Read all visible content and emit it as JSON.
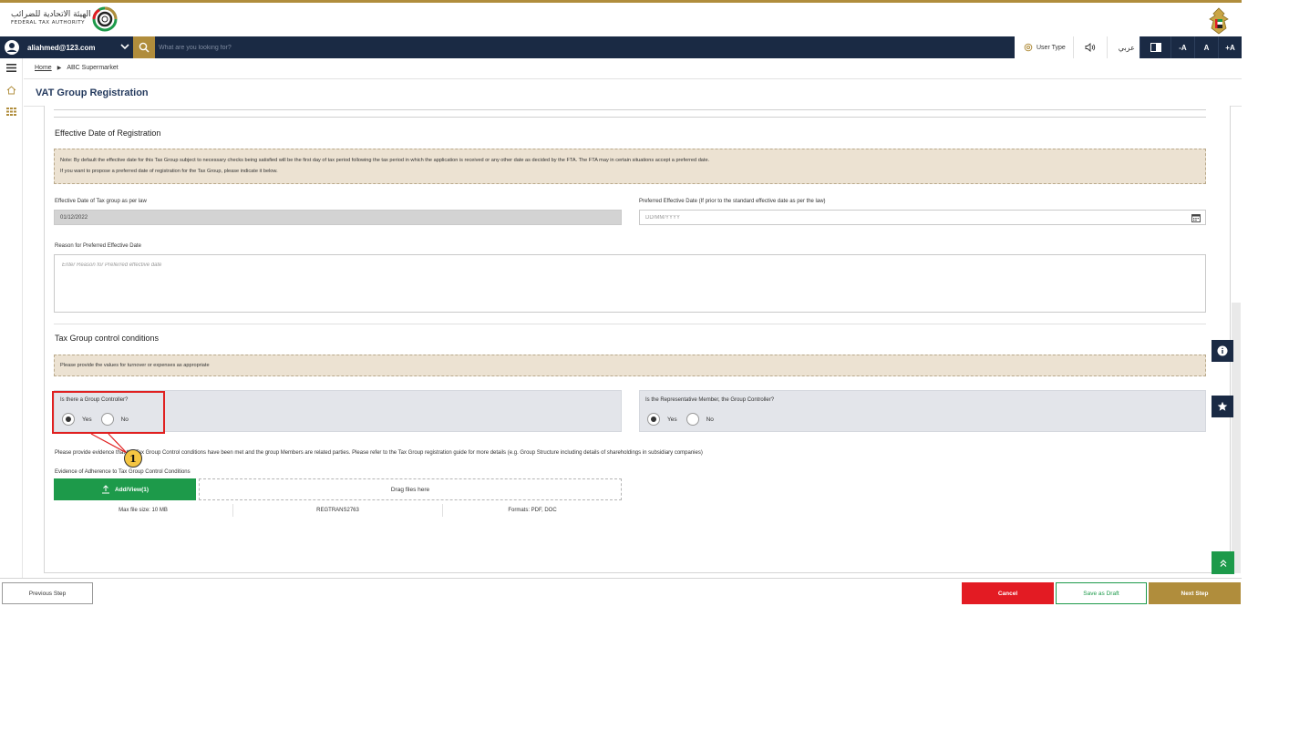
{
  "header": {
    "logo_ar": "الهيئة الاتحادية للضرائب",
    "logo_en": "FEDERAL TAX AUTHORITY"
  },
  "nav": {
    "user_email": "aliahmed@123.com",
    "search_placeholder": "What are you looking for?",
    "user_type_label": "User Type",
    "language_label": "عربي",
    "font_decrease": "-A",
    "font_normal": "A",
    "font_increase": "+A"
  },
  "breadcrumb": {
    "home": "Home",
    "current": "ABC Supermarket"
  },
  "page": {
    "title": "VAT Group Registration"
  },
  "effective_date": {
    "section_title": "Effective Date of Registration",
    "note_line1": "Note: By default the effective date for this Tax Group subject to necessary checks being satisfied will be the first day of tax period following the tax period in which the application is received or any other date as decided by the FTA. The FTA may in certain situations accept a preferred date.",
    "note_line2": "If you want to propose a preferred date of registration for the Tax Group, please indicate it below.",
    "law_date_label": "Effective Date of Tax group as per law",
    "law_date_value": "01/12/2022",
    "preferred_date_label": "Preferred Effective Date (If prior to the standard effective date as per the law)",
    "preferred_date_placeholder": "DD/MM/YYYY",
    "reason_label": "Reason for Preferred Effective Date",
    "reason_placeholder": "Enter Reason for Preferred effective date"
  },
  "control": {
    "section_title": "Tax Group control conditions",
    "note": "Please provide the values for turnover or expenses as appropriate",
    "q1": "Is there a Group Controller?",
    "q1_selected": "Yes",
    "q2": "Is the Representative Member, the Group Controller?",
    "q2_selected": "Yes",
    "yes_label": "Yes",
    "no_label": "No",
    "evidence_text": "Please provide evidence that the Tax Group Control conditions have been met and the group Members are related parties. Please refer to the Tax Group registration guide for more details (e.g. Group Structure including details of shareholdings in subsidiary companies)",
    "evidence_label": "Evidence of Adherence to Tax Group Control Conditions",
    "add_view_label": "Add/View(1)",
    "drag_label": "Drag files here",
    "max_size": "Max file size: 10 MB",
    "ref": "REGTRANS2763",
    "formats": "Formats: PDF, DOC"
  },
  "annotation": {
    "badge": "1"
  },
  "footer": {
    "previous": "Previous Step",
    "cancel": "Cancel",
    "save_draft": "Save as Draft",
    "next": "Next Step"
  },
  "colors": {
    "navy": "#1a2a44",
    "gold": "#b08d3c",
    "green": "#1d9a4a",
    "red": "#e31b23",
    "note_bg": "#ece2d2"
  }
}
